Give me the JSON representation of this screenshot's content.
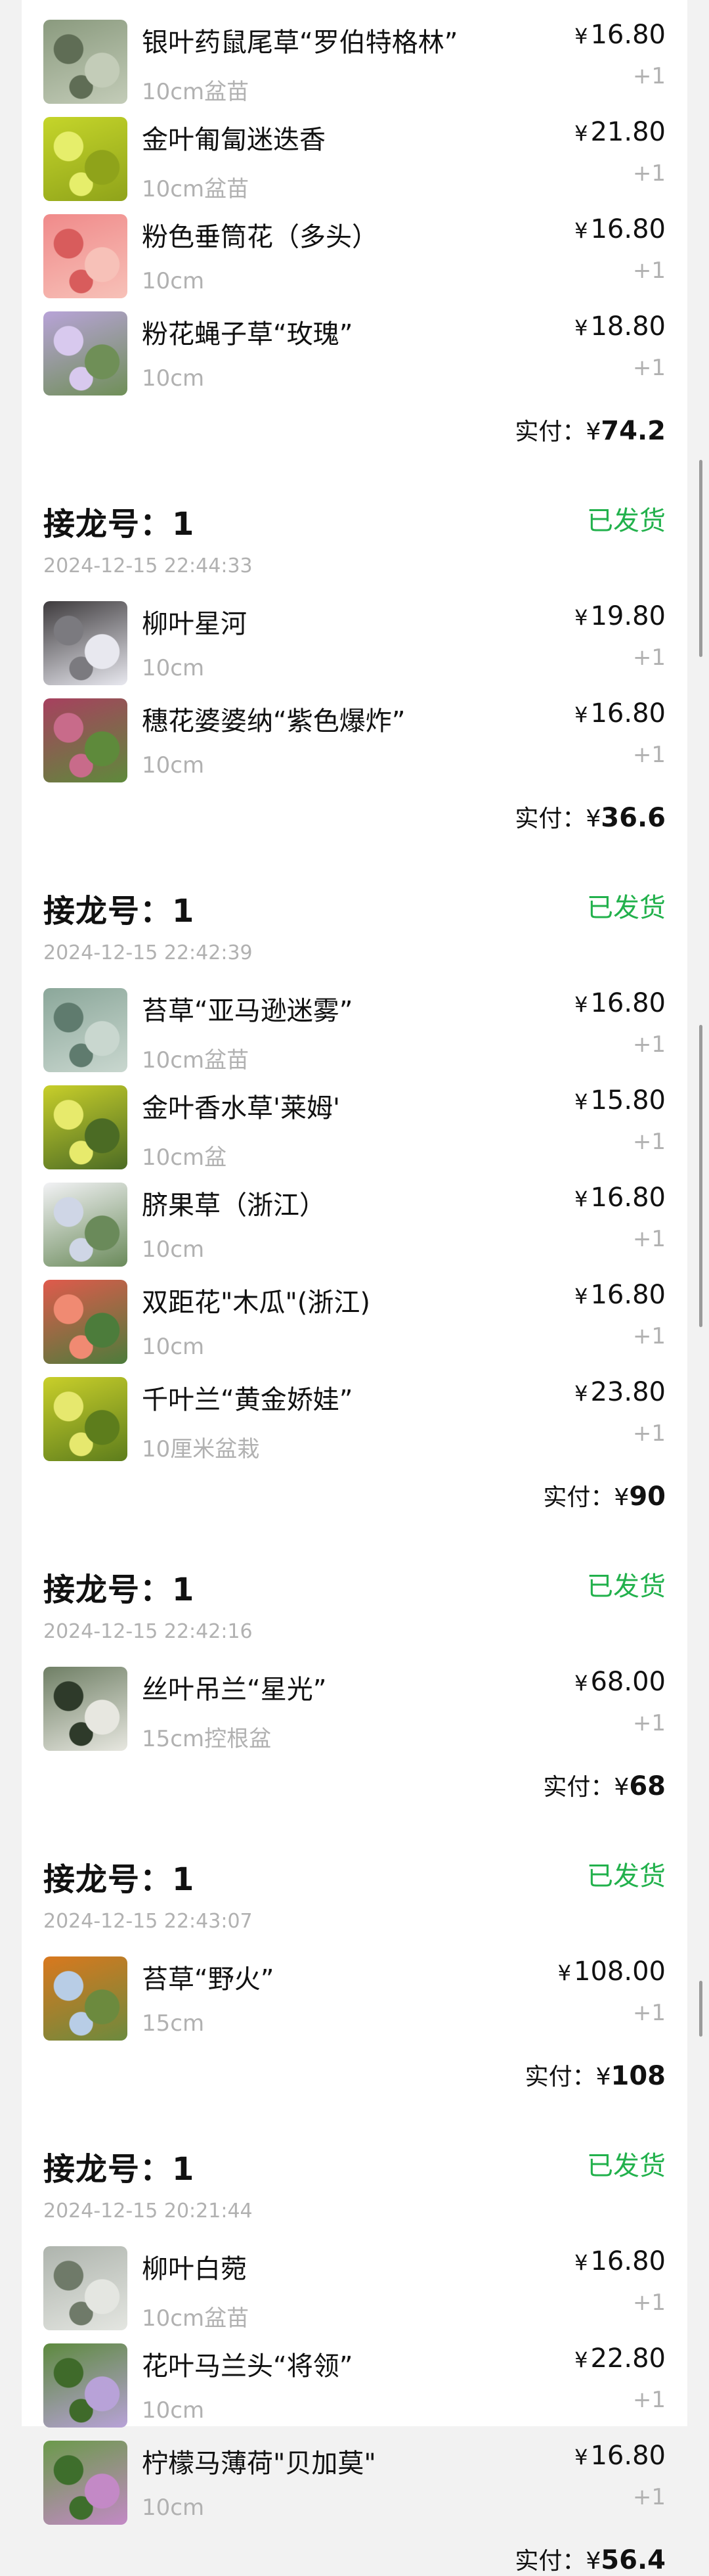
{
  "orders": [
    {
      "head_visible": false,
      "items": [
        {
          "name": "银叶药鼠尾草“罗伯特格林”",
          "spec": "10cm盆苗",
          "price": "16.80",
          "qty": "+1",
          "img_colors": [
            "#8a9a7e",
            "#c3ccb8",
            "#5f6d55"
          ]
        },
        {
          "name": "金叶匍匐迷迭香",
          "spec": "10cm盆苗",
          "price": "21.80",
          "qty": "+1",
          "img_colors": [
            "#c5d52a",
            "#8fa31a",
            "#e6ee6b"
          ]
        },
        {
          "name": "粉色垂筒花（多头）",
          "spec": "10cm",
          "price": "16.80",
          "qty": "+1",
          "img_colors": [
            "#f08a8a",
            "#f7c1b8",
            "#d85c5c"
          ]
        },
        {
          "name": "粉花蝇子草“玫瑰”",
          "spec": "10cm",
          "price": "18.80",
          "qty": "+1",
          "img_colors": [
            "#b8a3d8",
            "#6f8f57",
            "#d8c9ee"
          ]
        }
      ],
      "paid_label": "实付：¥",
      "paid_amount": "74.2"
    },
    {
      "head_visible": true,
      "no_label": "接龙号：1",
      "status": "已发货",
      "time": "2024-12-15 22:44:33",
      "items": [
        {
          "name": "柳叶星河",
          "spec": "10cm",
          "price": "19.80",
          "qty": "+1",
          "img_colors": [
            "#3e3b3d",
            "#e8e8ef",
            "#7b7a7f"
          ]
        },
        {
          "name": "穗花婆婆纳“紫色爆炸”",
          "spec": "10cm",
          "price": "16.80",
          "qty": "+1",
          "img_colors": [
            "#a7405f",
            "#5e8a3b",
            "#c86b8a"
          ]
        }
      ],
      "paid_label": "实付：¥",
      "paid_amount": "36.6"
    },
    {
      "head_visible": true,
      "no_label": "接龙号：1",
      "status": "已发货",
      "time": "2024-12-15 22:42:39",
      "items": [
        {
          "name": "苔草“亚马逊迷雾”",
          "spec": "10cm盆苗",
          "price": "16.80",
          "qty": "+1",
          "img_colors": [
            "#8ba79a",
            "#c9d7cf",
            "#5f7b6e"
          ]
        },
        {
          "name": "金叶香水草'莱姆'",
          "spec": "10cm盆",
          "price": "15.80",
          "qty": "+1",
          "img_colors": [
            "#c8cf2a",
            "#4b6b24",
            "#e7ea6c"
          ]
        },
        {
          "name": "脐果草（浙江）",
          "spec": "10cm",
          "price": "16.80",
          "qty": "+1",
          "img_colors": [
            "#f2f2f5",
            "#6a8a5a",
            "#cfd6e6"
          ]
        },
        {
          "name": "双距花\"木瓜\"(浙江)",
          "spec": "10cm",
          "price": "16.80",
          "qty": "+1",
          "img_colors": [
            "#e05a4c",
            "#4c7c3b",
            "#f08a72"
          ]
        },
        {
          "name": "千叶兰“黄金娇娃”",
          "spec": "10厘米盆栽",
          "price": "23.80",
          "qty": "+1",
          "img_colors": [
            "#c9cf2a",
            "#5d7d1c",
            "#e6e86e"
          ]
        }
      ],
      "paid_label": "实付：¥",
      "paid_amount": "90"
    },
    {
      "head_visible": true,
      "no_label": "接龙号：1",
      "status": "已发货",
      "time": "2024-12-15 22:42:16",
      "items": [
        {
          "name": "丝叶吊兰“星光”",
          "spec": "15cm控根盆",
          "price": "68.00",
          "qty": "+1",
          "img_colors": [
            "#6f7f65",
            "#e7e7e0",
            "#2e3a2a"
          ]
        }
      ],
      "paid_label": "实付：¥",
      "paid_amount": "68"
    },
    {
      "head_visible": true,
      "no_label": "接龙号：1",
      "status": "已发货",
      "time": "2024-12-15 22:43:07",
      "items": [
        {
          "name": "苔草“野火”",
          "spec": "15cm",
          "price": "108.00",
          "qty": "+1",
          "img_colors": [
            "#d9781e",
            "#6c8a3e",
            "#b8cde6"
          ]
        }
      ],
      "paid_label": "实付：¥",
      "paid_amount": "108"
    },
    {
      "head_visible": true,
      "no_label": "接龙号：1",
      "status": "已发货",
      "time": "2024-12-15 20:21:44",
      "items": [
        {
          "name": "柳叶白菀",
          "spec": "10cm盆苗",
          "price": "16.80",
          "qty": "+1",
          "img_colors": [
            "#aeb4ad",
            "#e4e6e1",
            "#6f7a69"
          ]
        },
        {
          "name": "花叶马兰头“将领”",
          "spec": "10cm",
          "price": "22.80",
          "qty": "+1",
          "img_colors": [
            "#5d8a3e",
            "#b8a2d8",
            "#3f6a2a"
          ]
        },
        {
          "name": "柠檬马薄荷\"贝加莫\"",
          "spec": "10cm",
          "price": "16.80",
          "qty": "+1",
          "img_colors": [
            "#6a9a4a",
            "#c389c6",
            "#3e6e2c"
          ]
        }
      ],
      "paid_label": "实付：¥",
      "paid_amount": "56.4"
    }
  ]
}
